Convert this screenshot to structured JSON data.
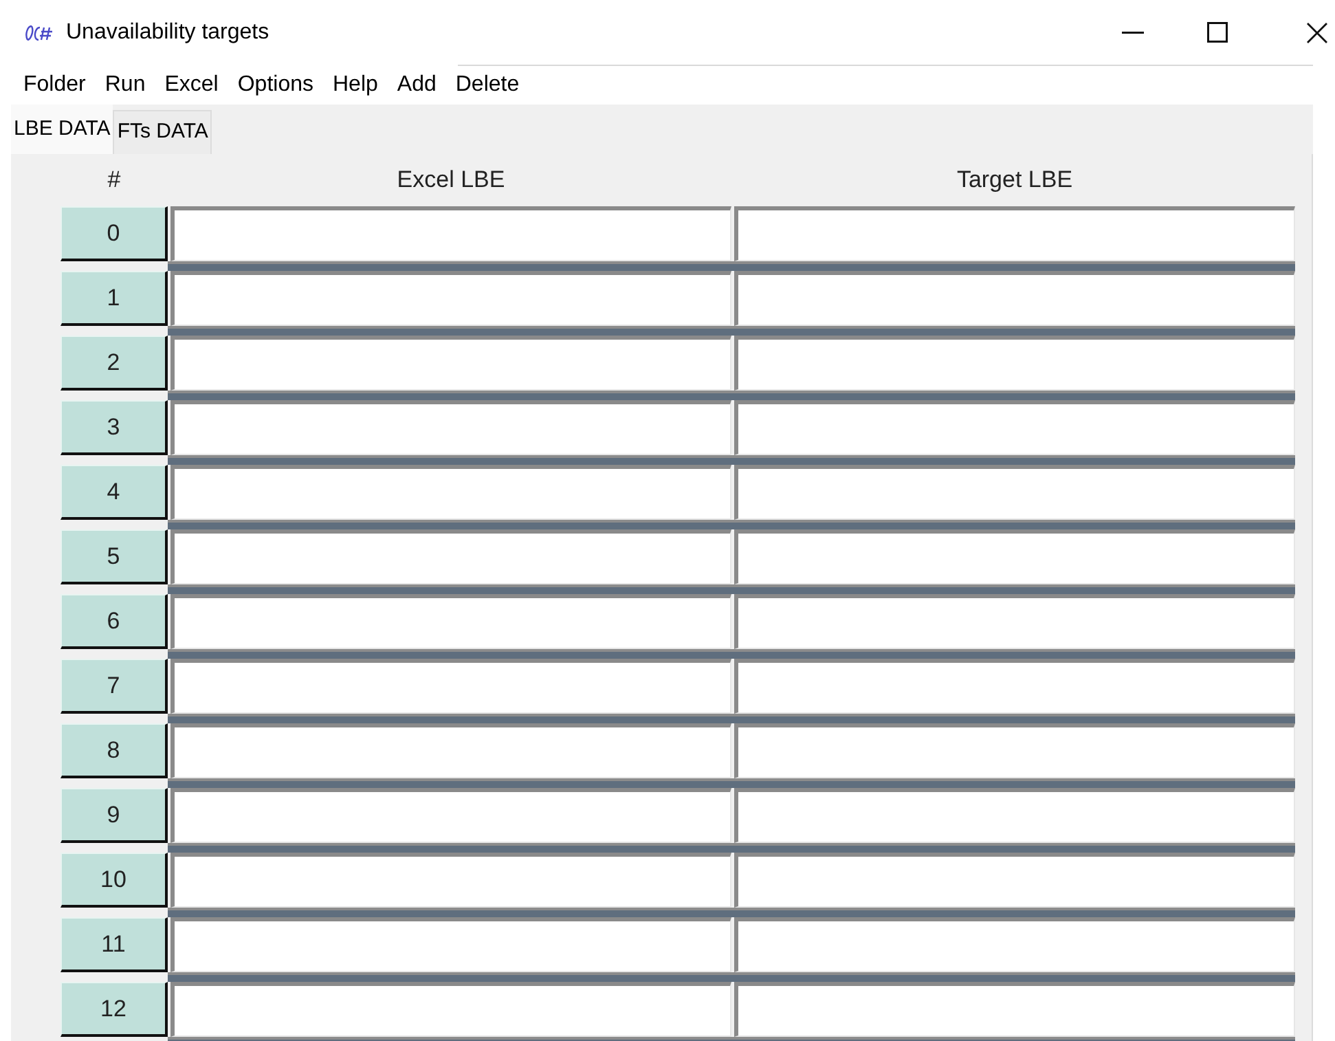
{
  "window": {
    "title": "Unavailability targets"
  },
  "menu": [
    "Folder",
    "Run",
    "Excel",
    "Options",
    "Help",
    "Add",
    "Delete"
  ],
  "tabs": [
    {
      "label": "LBE DATA",
      "selected": true
    },
    {
      "label": "FTs DATA",
      "selected": false
    }
  ],
  "table": {
    "columns": [
      "#",
      "Excel LBE",
      "Target LBE"
    ],
    "rows": [
      {
        "label": "0"
      },
      {
        "label": "1"
      },
      {
        "label": "2"
      },
      {
        "label": "3"
      },
      {
        "label": "4"
      },
      {
        "label": "5"
      },
      {
        "label": "6"
      },
      {
        "label": "7"
      },
      {
        "label": "8"
      },
      {
        "label": "9"
      },
      {
        "label": "10"
      },
      {
        "label": "11"
      },
      {
        "label": "12"
      }
    ]
  }
}
